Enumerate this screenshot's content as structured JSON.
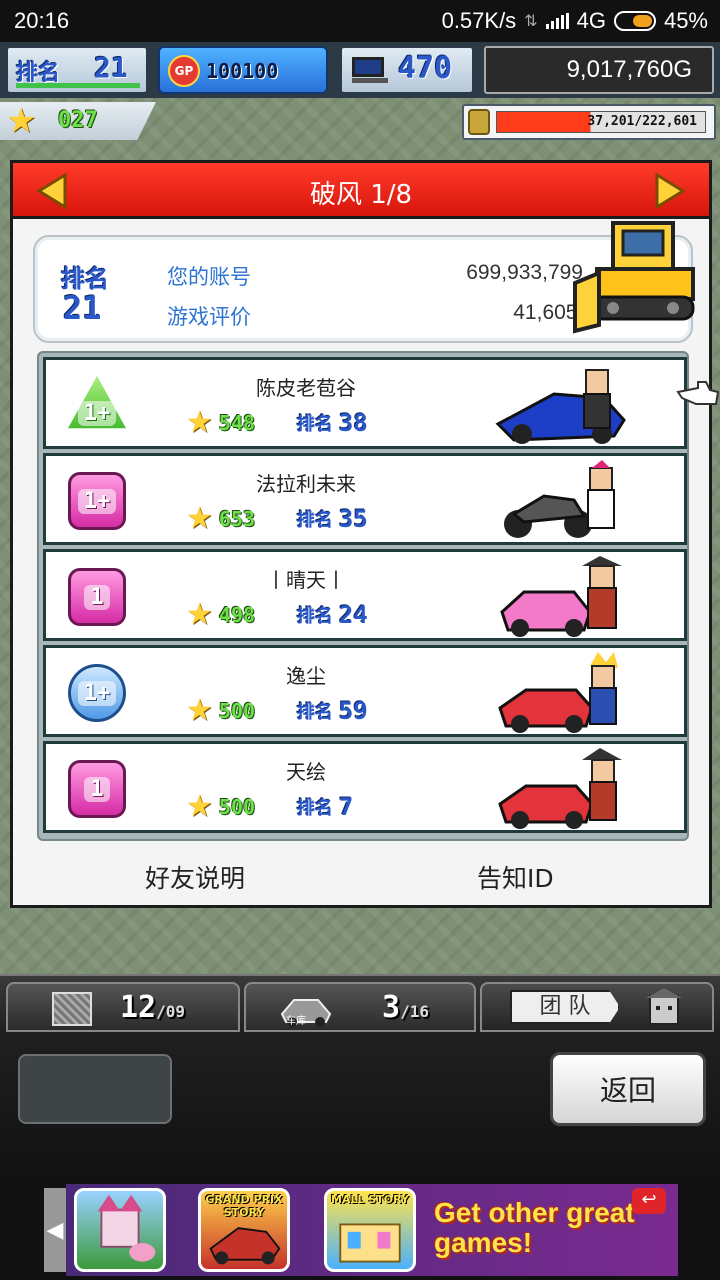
{
  "status_bar": {
    "time": "20:16",
    "speed": "0.57K/s",
    "network": "4G",
    "battery": "45%"
  },
  "hud": {
    "rank_label": "排名",
    "rank_value": "21",
    "gp_value": "100100",
    "pc_value": "470",
    "money": "9,017,760G",
    "stars": "027",
    "fuel": "37,201/222,601"
  },
  "dialog": {
    "title": "破风 1/8",
    "profile": {
      "rank_label": "排名",
      "rank_value": "21",
      "account_label": "您的账号",
      "account_value": "699,933,799",
      "rating_label": "游戏评价",
      "rating_value": "41,605pt"
    },
    "friends": [
      {
        "name": "陈皮老苞谷",
        "badge": "1+",
        "badge_style": "tri",
        "stars": "548",
        "rank_label": "排名",
        "rank": "38"
      },
      {
        "name": "法拉利未来",
        "badge": "1+",
        "badge_style": "pink",
        "stars": "653",
        "rank_label": "排名",
        "rank": "35"
      },
      {
        "name": "丨晴天丨",
        "badge": "1",
        "badge_style": "pink",
        "stars": "498",
        "rank_label": "排名",
        "rank": "24"
      },
      {
        "name": "逸尘",
        "badge": "1+",
        "badge_style": "blue",
        "stars": "500",
        "rank_label": "排名",
        "rank": "59"
      },
      {
        "name": "天绘",
        "badge": "1",
        "badge_style": "pink",
        "stars": "500",
        "rank_label": "排名",
        "rank": "7"
      }
    ],
    "footer": {
      "friend_info": "好友说明",
      "share_id": "告知ID"
    }
  },
  "bottom_tabs": {
    "tab1_count": "12",
    "tab1_total": "/09",
    "tab2_count": "3",
    "tab2_total": "/16",
    "tab2_label": "车库",
    "tab3_label": "团 队"
  },
  "panel": {
    "back_label": "返回"
  },
  "ad": {
    "app1": "",
    "app2": "GRAND PRIX STORY",
    "app3": "MALL STORY",
    "text": "Get other great games!"
  },
  "colors": {
    "header_red": "#e8200f",
    "accent_blue": "#2f74d2",
    "score_green": "#6de04a"
  }
}
